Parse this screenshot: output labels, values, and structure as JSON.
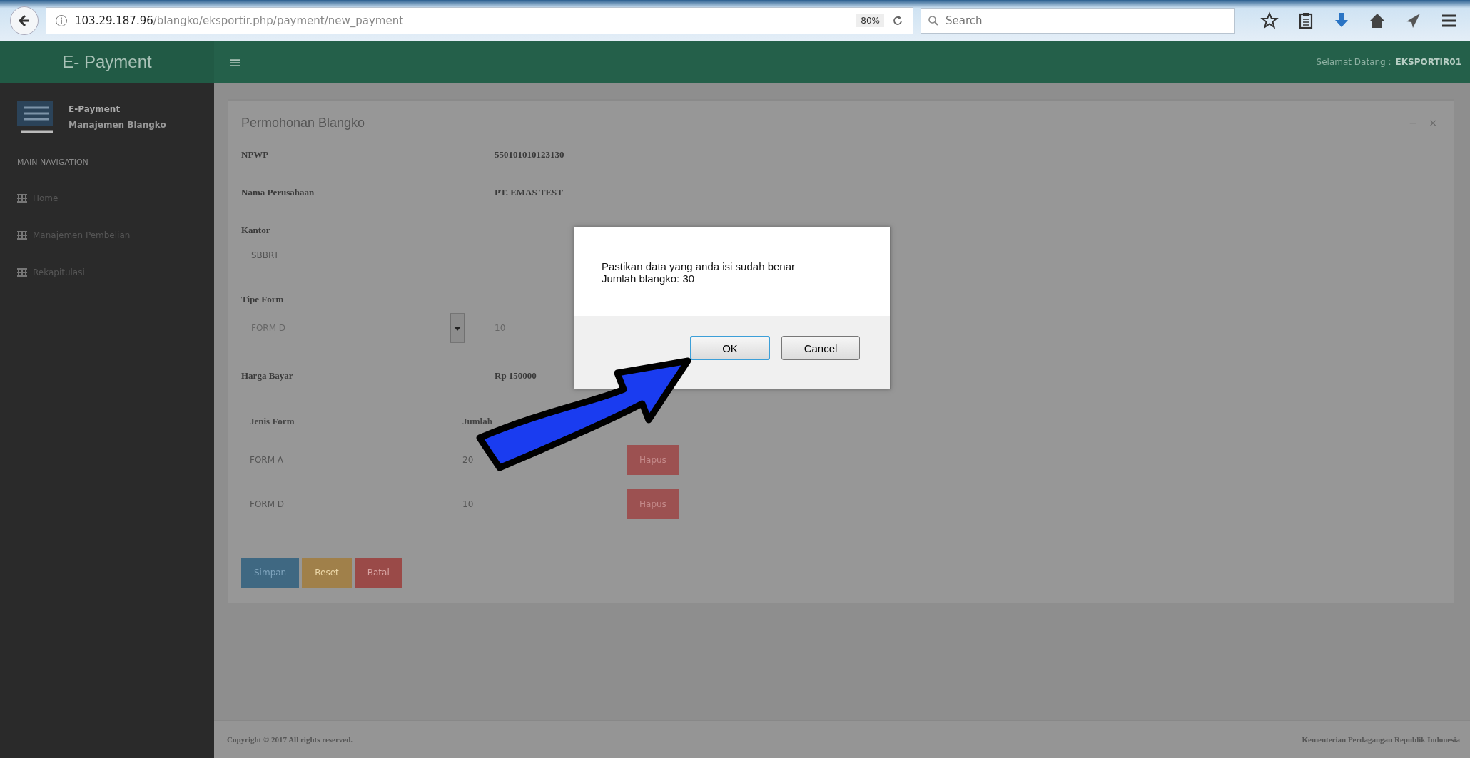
{
  "browser": {
    "url_host": "103.29.187.96",
    "url_path": "/blangko/eksportir.php/payment/new_payment",
    "zoom": "80%",
    "search": {
      "placeholder": "Search"
    }
  },
  "header": {
    "brand": "E- Payment",
    "menu_glyph": "≡",
    "welcome": "Selamat Datang :",
    "user": "EKSPORTIR01"
  },
  "sidebar": {
    "app_title": "E-Payment",
    "app_subtitle": "Manajemen Blangko",
    "section": "MAIN NAVIGATION",
    "items": [
      {
        "label": "Home",
        "selected": false
      },
      {
        "label": "Manajemen Pembelian",
        "selected": false
      },
      {
        "label": "Rekapitulasi",
        "selected": false
      }
    ]
  },
  "panel": {
    "title": "Permohonan Blangko",
    "tools": [
      "−",
      "×"
    ],
    "fields": [
      {
        "kind": "text",
        "label": "NPWP",
        "value": "550101010123130"
      },
      {
        "kind": "text",
        "label": "Nama Perusahaan",
        "value": "PT. EMAS TEST"
      },
      {
        "kind": "input",
        "label": "Kantor",
        "value": "SBBRT"
      },
      {
        "kind": "select",
        "label": "Tipe Form",
        "value": "FORM D",
        "amount": "10"
      },
      {
        "kind": "text",
        "label": "Harga Bayar",
        "value": "Rp 150000"
      }
    ],
    "table": {
      "columns": [
        "Jenis Form",
        "Jumlah"
      ],
      "rows": [
        {
          "form": "FORM A",
          "amount": "20",
          "action": "Hapus"
        },
        {
          "form": "FORM D",
          "amount": "10",
          "action": "Hapus"
        }
      ]
    },
    "buttons": [
      {
        "label": "Simpan",
        "kind": "primary"
      },
      {
        "label": "Reset",
        "kind": "warning"
      },
      {
        "label": "Batal",
        "kind": "danger"
      }
    ]
  },
  "footer": {
    "left": "Copyright © 2017 All rights reserved.",
    "right": "Kementerian Perdagangan Republik Indonesia"
  },
  "dialog": {
    "lines": [
      "Pastikan data yang anda isi sudah benar",
      "Jumlah blangko: 30"
    ],
    "buttons": [
      {
        "label": "OK",
        "selected": true
      },
      {
        "label": "Cancel",
        "selected": false
      }
    ]
  }
}
